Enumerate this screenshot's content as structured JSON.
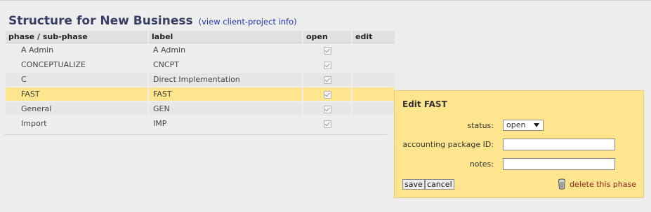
{
  "header": {
    "title": "Structure for New Business",
    "info_link": "(view client-project info)"
  },
  "table": {
    "columns": [
      "phase / sub-phase",
      "label",
      "open",
      "edit"
    ],
    "rows": [
      {
        "phase": "A Admin",
        "label": "A Admin",
        "open": true
      },
      {
        "phase": "CONCEPTUALIZE",
        "label": "CNCPT",
        "open": true
      },
      {
        "phase": "C",
        "label": "Direct Implementation",
        "open": true
      },
      {
        "phase": "FAST",
        "label": "FAST",
        "open": true,
        "selected": true
      },
      {
        "phase": "General",
        "label": "GEN",
        "open": true
      },
      {
        "phase": "Import",
        "label": "IMP",
        "open": true
      }
    ]
  },
  "edit_panel": {
    "title": "Edit FAST",
    "status_label": "status:",
    "status_value": "open",
    "accounting_label": "accounting package ID:",
    "accounting_value": "",
    "notes_label": "notes:",
    "notes_value": "",
    "save_label": "save",
    "cancel_label": "cancel",
    "delete_label": "delete this phase"
  },
  "colors": {
    "selected_row": "#ffe58e",
    "title": "#3a3f66",
    "link": "#2233aa",
    "delete_link": "#8b1a1a"
  }
}
